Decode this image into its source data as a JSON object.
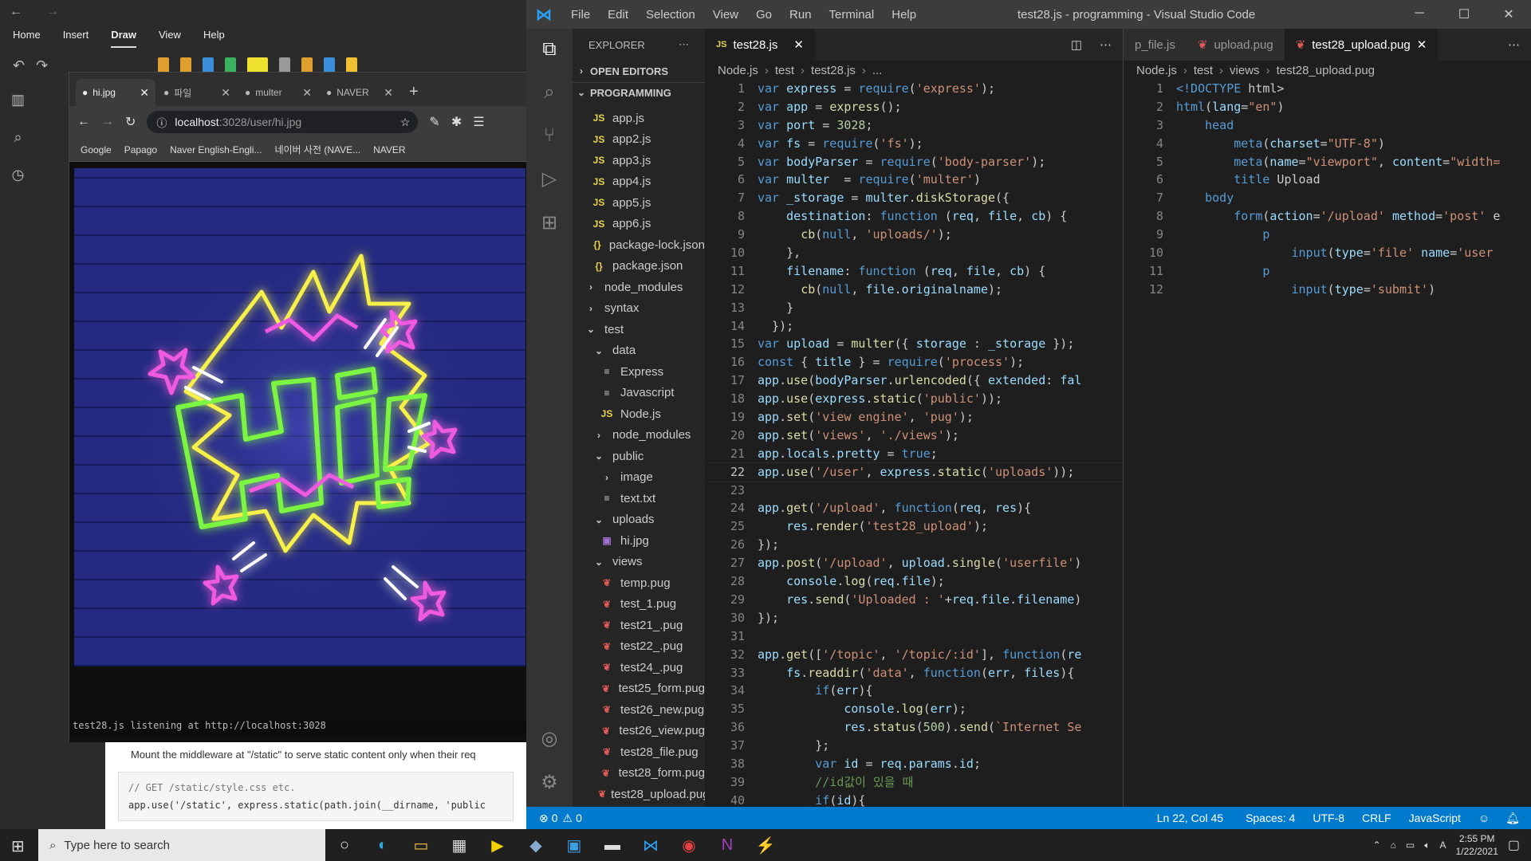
{
  "onenote": {
    "menu": [
      "Home",
      "Insert",
      "Draw",
      "View",
      "Help"
    ],
    "active_menu": "Draw",
    "page_text": "Mount the middleware at \"/static\" to serve static content only when their req",
    "code_comment": "// GET /static/style.css etc.",
    "code_line": "app.use('/static', express.static(path.join(__dirname, 'public"
  },
  "chrome": {
    "tabs": [
      {
        "label": "hi.jpg",
        "active": true
      },
      {
        "label": "파일",
        "active": false
      },
      {
        "label": "multer",
        "active": false
      },
      {
        "label": "NAVER",
        "active": false
      }
    ],
    "url_host": "localhost",
    "url_path": ":3028/user/hi.jpg",
    "bookmarks": [
      "Google",
      "Papago",
      "Naver English-Engli...",
      "네이버 사전 (NAVE...",
      "NAVER"
    ],
    "console_text": "test28.js listening at http://localhost:3028"
  },
  "vscode": {
    "title": "test28.js - programming - Visual Studio Code",
    "menu": [
      "File",
      "Edit",
      "Selection",
      "View",
      "Go",
      "Run",
      "Terminal",
      "Help"
    ],
    "explorer": {
      "header": "EXPLORER",
      "open_editors": "OPEN EDITORS",
      "workspace": "PROGRAMMING",
      "items": [
        {
          "label": "app.js",
          "type": "js",
          "indent": 1
        },
        {
          "label": "app2.js",
          "type": "js",
          "indent": 1
        },
        {
          "label": "app3.js",
          "type": "js",
          "indent": 1
        },
        {
          "label": "app4.js",
          "type": "js",
          "indent": 1
        },
        {
          "label": "app5.js",
          "type": "js",
          "indent": 1
        },
        {
          "label": "app6.js",
          "type": "js",
          "indent": 1
        },
        {
          "label": "package-lock.json",
          "type": "json",
          "indent": 1
        },
        {
          "label": "package.json",
          "type": "json",
          "indent": 1
        },
        {
          "label": "node_modules",
          "type": "folder-closed",
          "indent": 0
        },
        {
          "label": "syntax",
          "type": "folder-closed",
          "indent": 0
        },
        {
          "label": "test",
          "type": "folder-open",
          "indent": 0
        },
        {
          "label": "data",
          "type": "folder-open",
          "indent": 1
        },
        {
          "label": "Express",
          "type": "txt",
          "indent": 2
        },
        {
          "label": "Javascript",
          "type": "txt",
          "indent": 2
        },
        {
          "label": "Node.js",
          "type": "js",
          "indent": 2
        },
        {
          "label": "node_modules",
          "type": "folder-closed",
          "indent": 1
        },
        {
          "label": "public",
          "type": "folder-open",
          "indent": 1
        },
        {
          "label": "image",
          "type": "folder-closed",
          "indent": 2
        },
        {
          "label": "text.txt",
          "type": "txt",
          "indent": 2
        },
        {
          "label": "uploads",
          "type": "folder-open",
          "indent": 1
        },
        {
          "label": "hi.jpg",
          "type": "img",
          "indent": 2
        },
        {
          "label": "views",
          "type": "folder-open",
          "indent": 1
        },
        {
          "label": "temp.pug",
          "type": "pug",
          "indent": 2
        },
        {
          "label": "test_1.pug",
          "type": "pug",
          "indent": 2
        },
        {
          "label": "test21_.pug",
          "type": "pug",
          "indent": 2
        },
        {
          "label": "test22_.pug",
          "type": "pug",
          "indent": 2
        },
        {
          "label": "test24_.pug",
          "type": "pug",
          "indent": 2
        },
        {
          "label": "test25_form.pug",
          "type": "pug",
          "indent": 2
        },
        {
          "label": "test26_new.pug",
          "type": "pug",
          "indent": 2
        },
        {
          "label": "test26_view.pug",
          "type": "pug",
          "indent": 2
        },
        {
          "label": "test28_file.pug",
          "type": "pug",
          "indent": 2
        },
        {
          "label": "test28_form.pug",
          "type": "pug",
          "indent": 2
        },
        {
          "label": "test28_upload.pug",
          "type": "pug",
          "indent": 2
        }
      ]
    },
    "editor1": {
      "tab": "test28.js",
      "breadcrumb": [
        "Node.js",
        "test",
        "test28.js",
        "..."
      ],
      "current_line": 22,
      "lines": [
        "var express = require('express');",
        "var app = express();",
        "var port = 3028;",
        "var fs = require('fs');",
        "var bodyParser = require('body-parser');",
        "var multer  = require('multer')",
        "var _storage = multer.diskStorage({",
        "    destination: function (req, file, cb) {",
        "      cb(null, 'uploads/');",
        "    },",
        "    filename: function (req, file, cb) {",
        "      cb(null, file.originalname);",
        "    }",
        "  });",
        "var upload = multer({ storage : _storage });",
        "const { title } = require('process');",
        "app.use(bodyParser.urlencoded({ extended: fal",
        "app.use(express.static('public'));",
        "app.set('view engine', 'pug');",
        "app.set('views', './views');",
        "app.locals.pretty = true;",
        "app.use('/user', express.static('uploads'));",
        "",
        "app.get('/upload', function(req, res){",
        "    res.render('test28_upload');",
        "});",
        "app.post('/upload', upload.single('userfile')",
        "    console.log(req.file);",
        "    res.send('Uploaded : '+req.file.filename)",
        "});",
        "",
        "app.get(['/topic', '/topic/:id'], function(re",
        "    fs.readdir('data', function(err, files){",
        "        if(err){",
        "            console.log(err);",
        "            res.status(500).send(`Internet Se",
        "        };",
        "        var id = req.params.id;",
        "        //id값이 있을 때",
        "        if(id){"
      ]
    },
    "editor2": {
      "tabs": [
        "p_file.js",
        "upload.pug",
        "test28_upload.pug"
      ],
      "active_tab": "test28_upload.pug",
      "breadcrumb": [
        "Node.js",
        "test",
        "views",
        "test28_upload.pug"
      ],
      "lines": [
        "<!DOCTYPE html>",
        "html(lang=\"en\")",
        "    head",
        "        meta(charset=\"UTF-8\")",
        "        meta(name=\"viewport\", content=\"width=",
        "        title Upload",
        "    body",
        "        form(action='/upload' method='post' e",
        "            p",
        "                input(type='file' name='user",
        "            p",
        "                input(type='submit')"
      ]
    },
    "status": {
      "errors": "0",
      "warnings": "0",
      "position": "Ln 22, Col 45",
      "spaces": "Spaces: 4",
      "encoding": "UTF-8",
      "eol": "CRLF",
      "language": "JavaScript"
    }
  },
  "taskbar": {
    "search_placeholder": "Type here to search",
    "time": "2:55 PM",
    "date": "1/22/2021"
  },
  "colors": {
    "accent": "#007acc",
    "keyword": "#569cd6",
    "string": "#ce9178",
    "fn": "#dcdcaa",
    "var": "#9cdcfe",
    "comment": "#6a9955"
  }
}
